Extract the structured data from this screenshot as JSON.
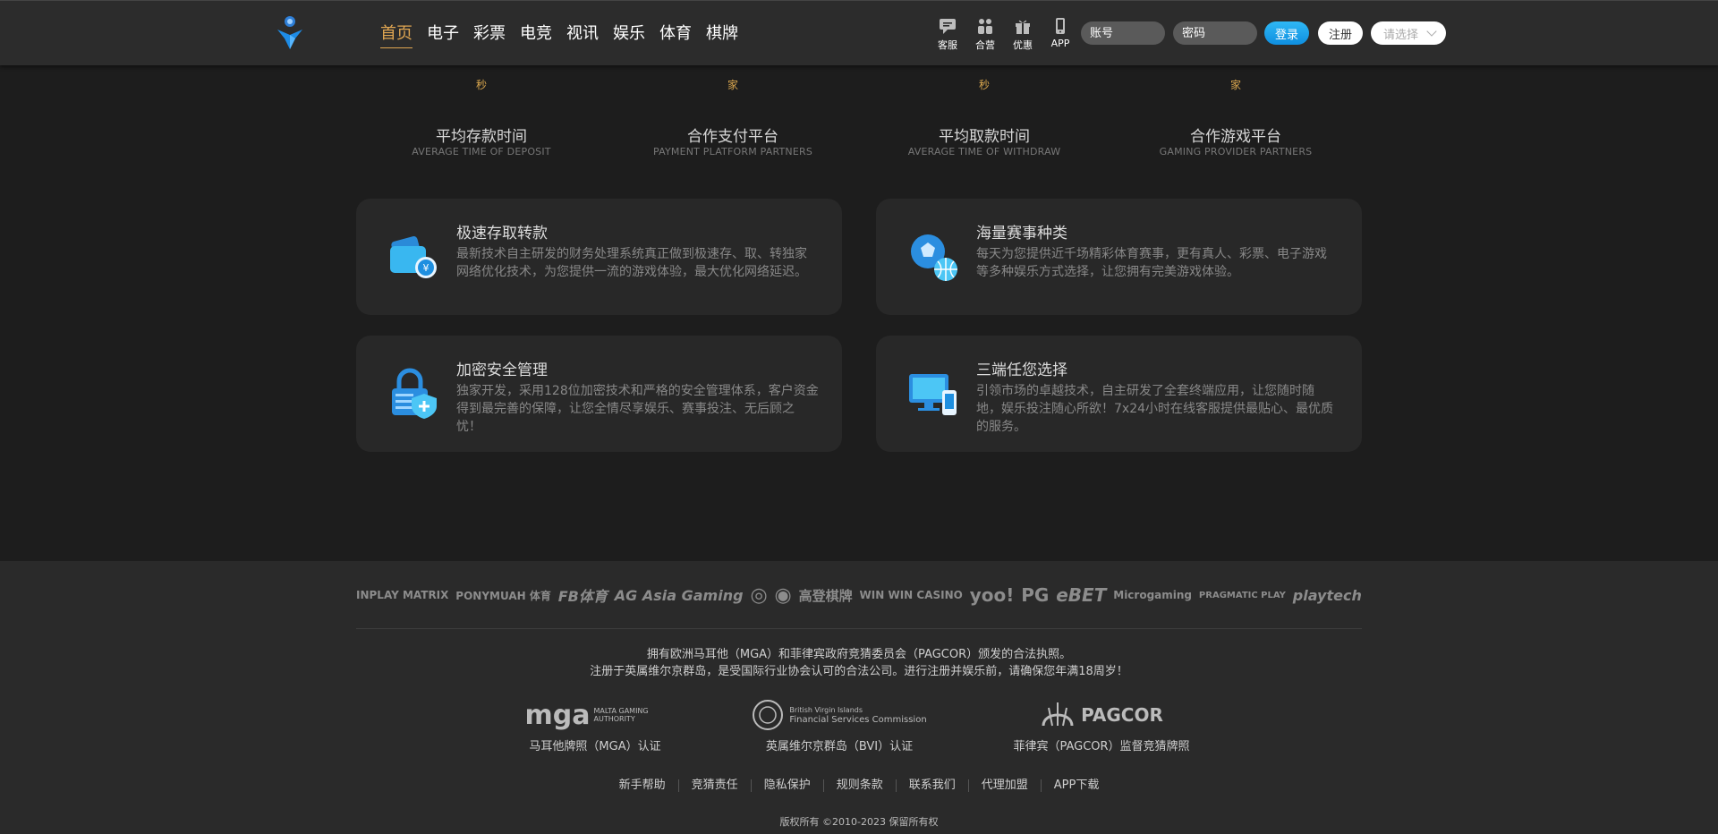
{
  "header": {
    "nav": [
      "首页",
      "电子",
      "彩票",
      "电竞",
      "视讯",
      "娱乐",
      "体育",
      "棋牌"
    ],
    "tools": [
      {
        "label": "客服",
        "icon": "chat-icon"
      },
      {
        "label": "合营",
        "icon": "partners-icon"
      },
      {
        "label": "优惠",
        "icon": "gift-icon"
      },
      {
        "label": "APP",
        "icon": "phone-icon"
      }
    ],
    "account_placeholder": "账号",
    "password_placeholder": "密码",
    "login_label": "登录",
    "register_label": "注册",
    "select_label": "请选择"
  },
  "stats": [
    {
      "unit": "秒",
      "title": "平均存款时间",
      "subtitle": "AVERAGE TIME OF DEPOSIT"
    },
    {
      "unit": "家",
      "title": "合作支付平台",
      "subtitle": "PAYMENT PLATFORM PARTNERS"
    },
    {
      "unit": "秒",
      "title": "平均取款时间",
      "subtitle": "AVERAGE TIME OF WITHDRAW"
    },
    {
      "unit": "家",
      "title": "合作游戏平台",
      "subtitle": "GAMING PROVIDER PARTNERS"
    }
  ],
  "features": [
    {
      "title": "极速存取转款",
      "icon": "wallet-icon",
      "desc": "最新技术自主研发的财务处理系统真正做到极速存、取、转独家网络优化技术，为您提供一流的游戏体验，最大优化网络延迟。"
    },
    {
      "title": "海量赛事种类",
      "icon": "sports-balls-icon",
      "desc": "每天为您提供近千场精彩体育赛事，更有真人、彩票、电子游戏等多种娱乐方式选择，让您拥有完美游戏体验。"
    },
    {
      "title": "加密安全管理",
      "icon": "lock-shield-icon",
      "desc": "独家开发，采用128位加密技术和严格的安全管理体系，客户资金得到最完善的保障，让您全情尽享娱乐、赛事投注、无后顾之忧！"
    },
    {
      "title": "三端任您选择",
      "icon": "devices-icon",
      "desc": "引领市场的卓越技术，自主研发了全套终端应用，让您随时随地，娱乐投注随心所欲！7x24小时在线客服提供最贴心、最优质的服务。"
    }
  ],
  "partners": [
    "INPLAY MATRIX",
    "PONYMUAH 体育",
    "FB体育",
    "AG Asia Gaming",
    "◎",
    "◉",
    "高登棋牌",
    "WIN WIN CASINO",
    "yoo!",
    "PG",
    "eBET",
    "Microgaming",
    "PRAGMATIC PLAY",
    "playtech"
  ],
  "license_text": [
    "拥有欧洲马耳他（MGA）和菲律宾政府竞猜委员会（PAGCOR）颁发的合法执照。",
    "注册于英属维尔京群岛，是受国际行业协会认可的合法公司。进行注册并娱乐前，请确保您年满18周岁！"
  ],
  "licenses": [
    {
      "logo": "mga",
      "logo_sub": "MALTA GAMING AUTHORITY",
      "caption": "马耳他牌照（MGA）认证"
    },
    {
      "logo": "British Virgin Islands",
      "logo_sub": "Financial Services Commission",
      "caption": "英属维尔京群岛（BVI）认证"
    },
    {
      "logo": "PAGCOR",
      "logo_sub": "",
      "caption": "菲律宾（PAGCOR）监督竞猜牌照"
    }
  ],
  "footer_links": [
    "新手帮助",
    "竞猜责任",
    "隐私保护",
    "规则条款",
    "联系我们",
    "代理加盟",
    "APP下载"
  ],
  "copyright": "版权所有 ©2010-2023 保留所有权"
}
